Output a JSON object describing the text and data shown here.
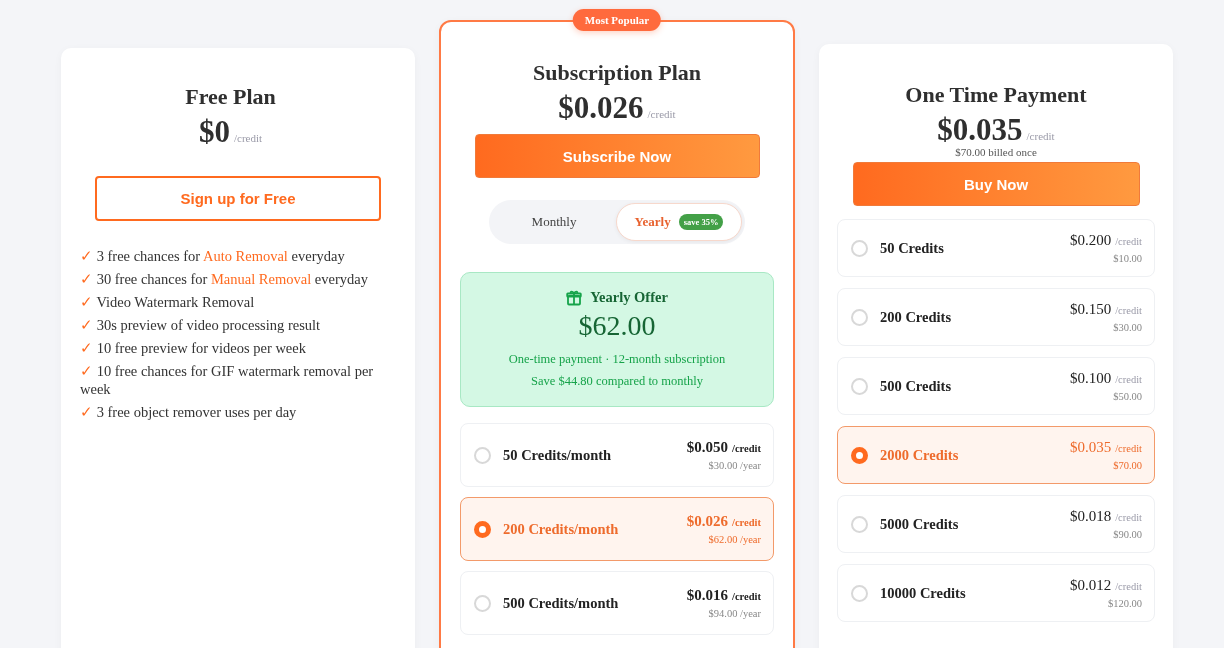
{
  "cards": [
    {
      "kind": "free",
      "title": "Free Plan",
      "price": "$0",
      "unit": "/credit",
      "button": "Sign up for Free",
      "features": [
        {
          "check": "✓",
          "parts": [
            {
              "text": "3 free chances for ",
              "highlight": false
            },
            {
              "text": "Auto Removal",
              "highlight": true
            },
            {
              "text": " everyday",
              "highlight": false
            }
          ]
        },
        {
          "check": "✓",
          "parts": [
            {
              "text": "30 free chances for ",
              "highlight": false
            },
            {
              "text": "Manual Removal",
              "highlight": true
            },
            {
              "text": " everyday",
              "highlight": false
            }
          ]
        },
        {
          "check": "✓",
          "parts": [
            {
              "text": "Video Watermark Removal",
              "highlight": false
            }
          ]
        },
        {
          "check": "✓",
          "parts": [
            {
              "text": "30s preview of video processing result",
              "highlight": false
            }
          ]
        },
        {
          "check": "✓",
          "parts": [
            {
              "text": "10 free preview for videos per week",
              "highlight": false
            }
          ]
        },
        {
          "check": "✓",
          "parts": [
            {
              "text": "10 free chances for GIF watermark removal per week",
              "highlight": false
            }
          ]
        },
        {
          "check": "✓",
          "parts": [
            {
              "text": "3 free object remover uses per day",
              "highlight": false
            }
          ]
        }
      ]
    },
    {
      "kind": "subscription",
      "badge": "Most Popular",
      "title": "Subscription Plan",
      "price": "$0.026",
      "unit": "/credit",
      "button": "Subscribe Now",
      "toggle": [
        {
          "label": "Monthly",
          "selected": false
        },
        {
          "label": "Yearly",
          "selected": true,
          "tag": "save 35%"
        }
      ],
      "offer": {
        "title": "Yearly Offer",
        "amount": "$62.00",
        "lines": [
          "One-time payment · 12-month subscription",
          "Save $44.80 compared to monthly"
        ]
      },
      "options": [
        {
          "name": "50 Credits/month",
          "price": "$0.050",
          "unit": "/credit",
          "total": "$30.00 /year",
          "selected": false
        },
        {
          "name": "200 Credits/month",
          "price": "$0.026",
          "unit": "/credit",
          "total": "$62.00 /year",
          "selected": true
        },
        {
          "name": "500 Credits/month",
          "price": "$0.016",
          "unit": "/credit",
          "total": "$94.00 /year",
          "selected": false
        }
      ]
    },
    {
      "kind": "onetime",
      "title": "One Time Payment",
      "price": "$0.035",
      "unit": "/credit",
      "note": "$70.00 billed once",
      "button": "Buy Now",
      "options": [
        {
          "name": "50 Credits",
          "price": "$0.200",
          "unit": "/credit",
          "total": "$10.00",
          "selected": false
        },
        {
          "name": "200 Credits",
          "price": "$0.150",
          "unit": "/credit",
          "total": "$30.00",
          "selected": false
        },
        {
          "name": "500 Credits",
          "price": "$0.100",
          "unit": "/credit",
          "total": "$50.00",
          "selected": false
        },
        {
          "name": "2000 Credits",
          "price": "$0.035",
          "unit": "/credit",
          "total": "$70.00",
          "selected": true
        },
        {
          "name": "5000 Credits",
          "price": "$0.018",
          "unit": "/credit",
          "total": "$90.00",
          "selected": false
        },
        {
          "name": "10000 Credits",
          "price": "$0.012",
          "unit": "/credit",
          "total": "$120.00",
          "selected": false
        }
      ]
    }
  ]
}
